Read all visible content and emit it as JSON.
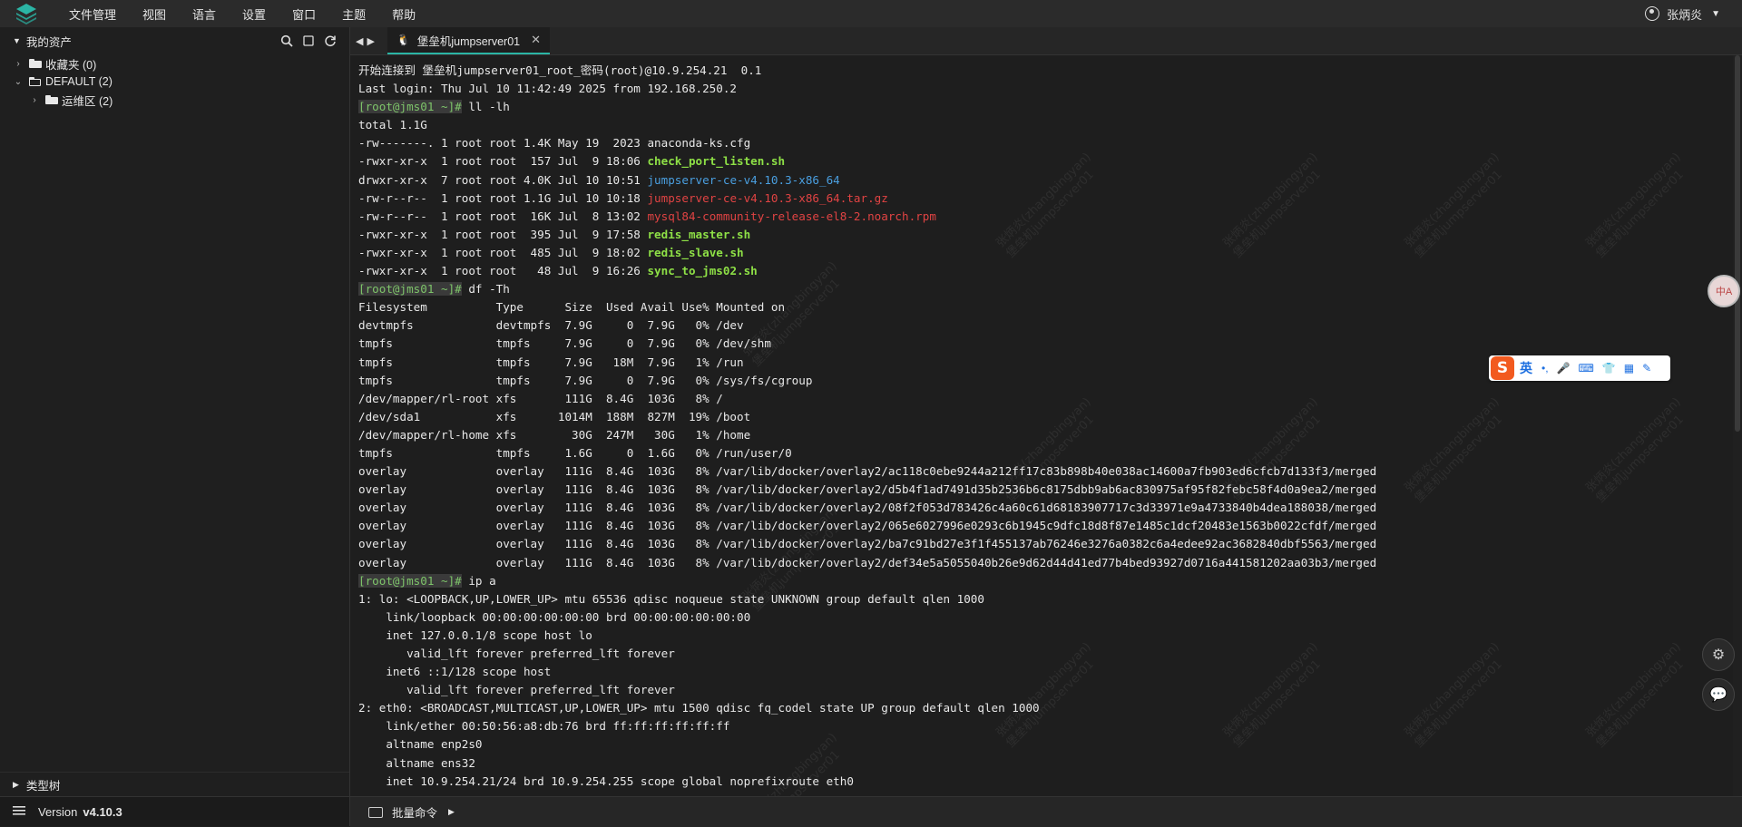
{
  "menu": [
    "文件管理",
    "视图",
    "语言",
    "设置",
    "窗口",
    "主题",
    "帮助"
  ],
  "user": {
    "name": "张炳炎"
  },
  "sidebar": {
    "title": "我的资产",
    "tree": [
      {
        "label": "收藏夹 (0)",
        "level": 0,
        "expanded": false
      },
      {
        "label": "DEFAULT (2)",
        "level": 0,
        "expanded": true
      },
      {
        "label": "运维区 (2)",
        "level": 1,
        "expanded": false
      }
    ],
    "type_tree": "类型树",
    "version_label": "Version",
    "version_value": "v4.10.3"
  },
  "tab": {
    "title": "堡垒机jumpserver01",
    "close": "✕"
  },
  "bottom": {
    "batch_command": "批量命令"
  },
  "watermark": {
    "line1": "张炳炎(zhangbingyan)",
    "line2": "堡垒机jumpserver01"
  },
  "ime": {
    "logo": "S",
    "mode": "英"
  },
  "float_avatar": "中A",
  "terminal": {
    "lines": [
      [
        {
          "t": "开始连接到 堡垒机jumpserver01_root_密码(root)@10.9.254.21  0.1",
          "c": "white"
        }
      ],
      [
        {
          "t": "Last login: Thu Jul 10 11:42:49 2025 from 192.168.250.2",
          "c": "white"
        }
      ],
      [
        {
          "t": "[root@jms01 ~]#",
          "c": "prompt"
        },
        {
          "t": " ll -lh",
          "c": "white"
        }
      ],
      [
        {
          "t": "total 1.1G",
          "c": "white"
        }
      ],
      [
        {
          "t": "-rw-------. 1 root root 1.4K May 19  2023 anaconda-ks.cfg",
          "c": "white"
        }
      ],
      [
        {
          "t": "-rwxr-xr-x  1 root root  157 Jul  9 18:06 ",
          "c": "white"
        },
        {
          "t": "check_port_listen.sh",
          "c": "green"
        }
      ],
      [
        {
          "t": "drwxr-xr-x  7 root root 4.0K Jul 10 10:51 ",
          "c": "white"
        },
        {
          "t": "jumpserver-ce-v4.10.3-x86_64",
          "c": "blue"
        }
      ],
      [
        {
          "t": "-rw-r--r--  1 root root 1.1G Jul 10 10:18 ",
          "c": "white"
        },
        {
          "t": "jumpserver-ce-v4.10.3-x86_64.tar.gz",
          "c": "red"
        }
      ],
      [
        {
          "t": "-rw-r--r--  1 root root  16K Jul  8 13:02 ",
          "c": "white"
        },
        {
          "t": "mysql84-community-release-el8-2.noarch.rpm",
          "c": "red"
        }
      ],
      [
        {
          "t": "-rwxr-xr-x  1 root root  395 Jul  9 17:58 ",
          "c": "white"
        },
        {
          "t": "redis_master.sh",
          "c": "green"
        }
      ],
      [
        {
          "t": "-rwxr-xr-x  1 root root  485 Jul  9 18:02 ",
          "c": "white"
        },
        {
          "t": "redis_slave.sh",
          "c": "green"
        }
      ],
      [
        {
          "t": "-rwxr-xr-x  1 root root   48 Jul  9 16:26 ",
          "c": "white"
        },
        {
          "t": "sync_to_jms02.sh",
          "c": "green"
        }
      ],
      [
        {
          "t": "[root@jms01 ~]#",
          "c": "prompt"
        },
        {
          "t": " df -Th",
          "c": "white"
        }
      ],
      [
        {
          "t": "Filesystem          Type      Size  Used Avail Use% Mounted on",
          "c": "white"
        }
      ],
      [
        {
          "t": "devtmpfs            devtmpfs  7.9G     0  7.9G   0% /dev",
          "c": "white"
        }
      ],
      [
        {
          "t": "tmpfs               tmpfs     7.9G     0  7.9G   0% /dev/shm",
          "c": "white"
        }
      ],
      [
        {
          "t": "tmpfs               tmpfs     7.9G   18M  7.9G   1% /run",
          "c": "white"
        }
      ],
      [
        {
          "t": "tmpfs               tmpfs     7.9G     0  7.9G   0% /sys/fs/cgroup",
          "c": "white"
        }
      ],
      [
        {
          "t": "/dev/mapper/rl-root xfs       111G  8.4G  103G   8% /",
          "c": "white"
        }
      ],
      [
        {
          "t": "/dev/sda1           xfs      1014M  188M  827M  19% /boot",
          "c": "white"
        }
      ],
      [
        {
          "t": "/dev/mapper/rl-home xfs        30G  247M   30G   1% /home",
          "c": "white"
        }
      ],
      [
        {
          "t": "tmpfs               tmpfs     1.6G     0  1.6G   0% /run/user/0",
          "c": "white"
        }
      ],
      [
        {
          "t": "overlay             overlay   111G  8.4G  103G   8% /var/lib/docker/overlay2/ac118c0ebe9244a212ff17c83b898b40e038ac14600a7fb903ed6cfcb7d133f3/merged",
          "c": "white"
        }
      ],
      [
        {
          "t": "overlay             overlay   111G  8.4G  103G   8% /var/lib/docker/overlay2/d5b4f1ad7491d35b2536b6c8175dbb9ab6ac830975af95f82febc58f4d0a9ea2/merged",
          "c": "white"
        }
      ],
      [
        {
          "t": "overlay             overlay   111G  8.4G  103G   8% /var/lib/docker/overlay2/08f2f053d783426c4a60c61d68183907717c3d33971e9a4733840b4dea188038/merged",
          "c": "white"
        }
      ],
      [
        {
          "t": "overlay             overlay   111G  8.4G  103G   8% /var/lib/docker/overlay2/065e6027996e0293c6b1945c9dfc18d8f87e1485c1dcf20483e1563b0022cfdf/merged",
          "c": "white"
        }
      ],
      [
        {
          "t": "overlay             overlay   111G  8.4G  103G   8% /var/lib/docker/overlay2/ba7c91bd27e3f1f455137ab76246e3276a0382c6a4edee92ac3682840dbf5563/merged",
          "c": "white"
        }
      ],
      [
        {
          "t": "overlay             overlay   111G  8.4G  103G   8% /var/lib/docker/overlay2/def34e5a5055040b26e9d62d44d41ed77b4bed93927d0716a441581202aa03b3/merged",
          "c": "white"
        }
      ],
      [
        {
          "t": "[root@jms01 ~]#",
          "c": "prompt"
        },
        {
          "t": " ip a",
          "c": "white"
        }
      ],
      [
        {
          "t": "1: lo: <LOOPBACK,UP,LOWER_UP> mtu 65536 qdisc noqueue state UNKNOWN group default qlen 1000",
          "c": "white"
        }
      ],
      [
        {
          "t": "    link/loopback 00:00:00:00:00:00 brd 00:00:00:00:00:00",
          "c": "white"
        }
      ],
      [
        {
          "t": "    inet 127.0.0.1/8 scope host lo",
          "c": "white"
        }
      ],
      [
        {
          "t": "       valid_lft forever preferred_lft forever",
          "c": "white"
        }
      ],
      [
        {
          "t": "    inet6 ::1/128 scope host",
          "c": "white"
        }
      ],
      [
        {
          "t": "       valid_lft forever preferred_lft forever",
          "c": "white"
        }
      ],
      [
        {
          "t": "2: eth0: <BROADCAST,MULTICAST,UP,LOWER_UP> mtu 1500 qdisc fq_codel state UP group default qlen 1000",
          "c": "white"
        }
      ],
      [
        {
          "t": "    link/ether 00:50:56:a8:db:76 brd ff:ff:ff:ff:ff:ff",
          "c": "white"
        }
      ],
      [
        {
          "t": "    altname enp2s0",
          "c": "white"
        }
      ],
      [
        {
          "t": "    altname ens32",
          "c": "white"
        }
      ],
      [
        {
          "t": "    inet 10.9.254.21/24 brd 10.9.254.255 scope global noprefixroute eth0",
          "c": "white"
        }
      ]
    ]
  }
}
